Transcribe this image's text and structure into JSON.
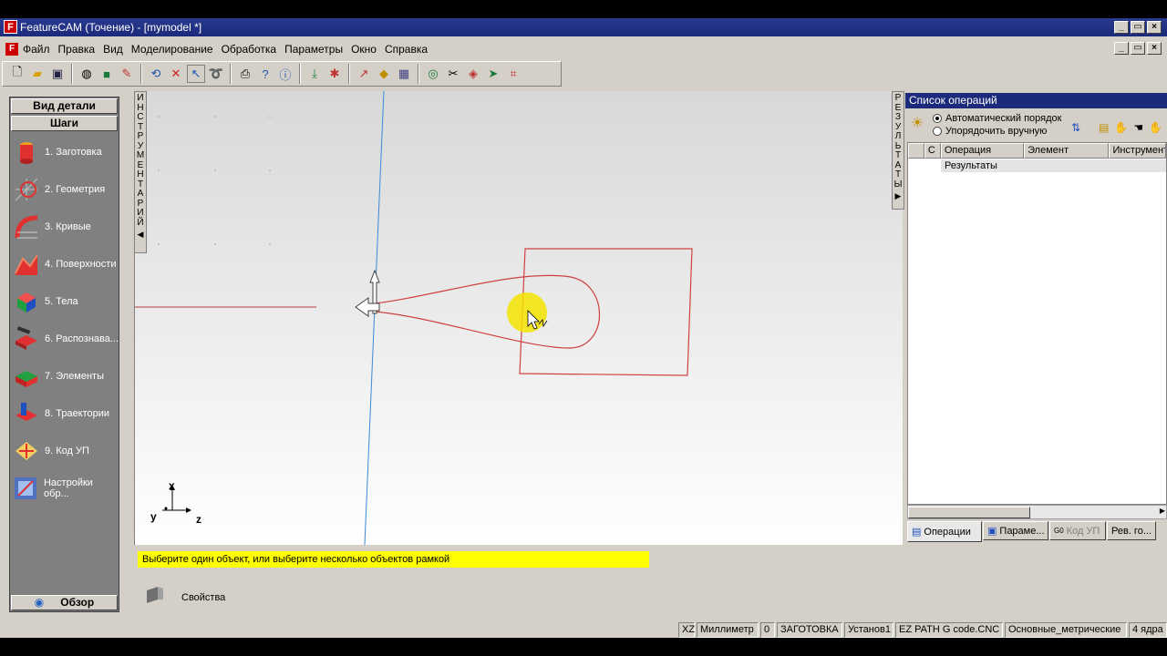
{
  "window": {
    "title": "FeatureCAM (Точение) - [mymodel *]",
    "app_letter": "F"
  },
  "menu": [
    "Файл",
    "Правка",
    "Вид",
    "Моделирование",
    "Обработка",
    "Параметры",
    "Окно",
    "Справка"
  ],
  "left_panel": {
    "header_top": "Вид детали",
    "header_steps": "Шаги",
    "steps": [
      "1. Заготовка",
      "2. Геометрия",
      "3. Кривые",
      "4. Поверхности",
      "5. Тела",
      "6. Распознава...",
      "7. Элементы",
      "8. Траектории",
      "9. Код УП",
      "Настройки обр..."
    ],
    "footer": "Обзор"
  },
  "vtab_left": {
    "letters": [
      "И",
      "Н",
      "С",
      "Т",
      "Р",
      "У",
      "М",
      "Е",
      "Н",
      "Т",
      "А",
      "Р",
      "И",
      "Й"
    ]
  },
  "vtab_right": {
    "letters": [
      "Р",
      "Е",
      "З",
      "У",
      "Л",
      "Ь",
      "Т",
      "А",
      "Т",
      "Ы"
    ]
  },
  "axes": {
    "x": "x",
    "y": "y",
    "z": "z"
  },
  "ops_panel": {
    "title": "Список операций",
    "radio_auto": "Автоматический порядок",
    "radio_manual": "Упорядочить вручную",
    "columns": [
      "С",
      "Операция",
      "Элемент",
      "Инструмент"
    ],
    "results_row": "Результаты",
    "tabs": [
      "Операции",
      "Параме...",
      "Код УП",
      "Рев. го..."
    ]
  },
  "prompt": "Выберите один объект, или выберите несколько объектов рамкой",
  "props_label": "Свойства",
  "status": [
    "XZ",
    "Миллиметр",
    "0",
    "ЗАГОТОВКА",
    "Установ1",
    "EZ PATH G code.CNC",
    "Основные_метрические",
    "4 ядра"
  ],
  "colors": {
    "titlebar": "#1b2a7a",
    "curve": "#d04040",
    "axis": "#3a8ad8",
    "highlight": "#f5e400"
  }
}
